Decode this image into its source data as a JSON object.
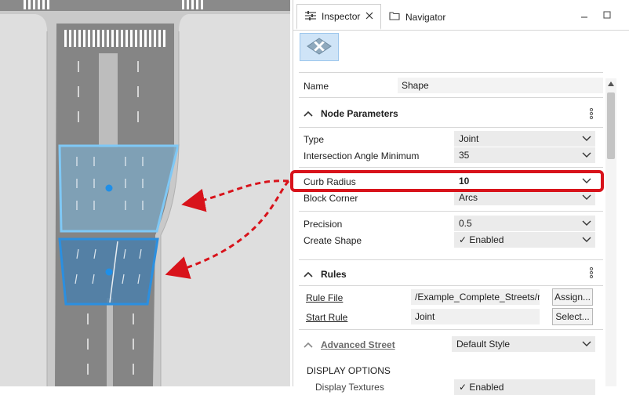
{
  "tabs": [
    {
      "label": "Inspector",
      "icon": "sliders-icon"
    },
    {
      "label": "Navigator",
      "icon": "folder-icon"
    }
  ],
  "name_row": {
    "label": "Name",
    "value": "Shape"
  },
  "node_parameters": {
    "title": "Node Parameters",
    "rows": [
      {
        "label": "Type",
        "value": "Joint"
      },
      {
        "label": "Intersection Angle Minimum",
        "value": "35"
      },
      {
        "label": "Curb Radius",
        "value": "10"
      },
      {
        "label": "Block Corner",
        "value": "Arcs"
      },
      {
        "label": "Precision",
        "value": "0.5"
      },
      {
        "label": "Create Shape",
        "value": "✓ Enabled"
      }
    ]
  },
  "rules": {
    "title": "Rules",
    "rule_file": {
      "label": "Rule File",
      "value": "/Example_Complete_Streets/ru",
      "button": "Assign..."
    },
    "start_rule": {
      "label": "Start Rule",
      "value": "Joint",
      "button": "Select..."
    }
  },
  "advanced_street": {
    "label": "Advanced Street",
    "value": "Default Style"
  },
  "display_options": {
    "title": "DISPLAY OPTIONS",
    "first_row_label": "Display Textures",
    "first_row_value": "✓ Enabled"
  },
  "colors": {
    "accent": "#2b8fe0",
    "highlight": "#d8131b"
  }
}
